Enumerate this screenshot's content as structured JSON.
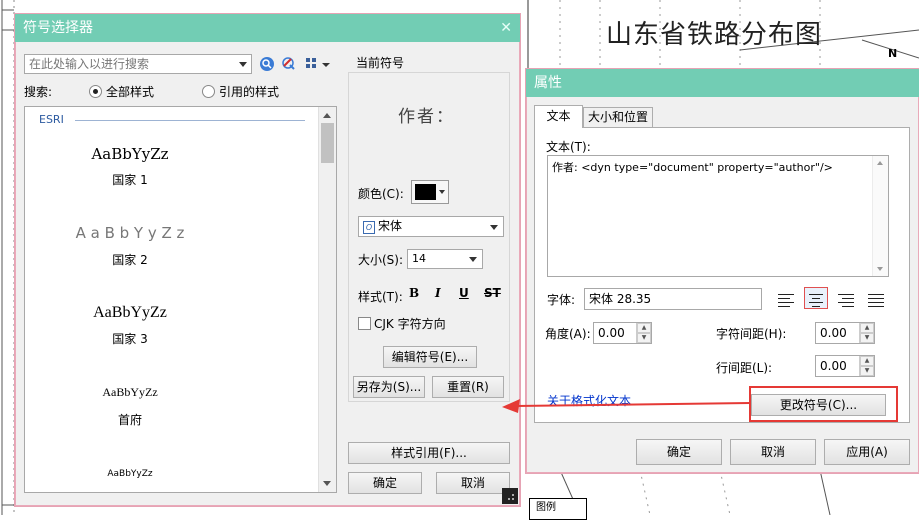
{
  "map": {
    "title": "山东省铁路分布图",
    "north": "N",
    "legend_label": "图例"
  },
  "symbol_selector": {
    "title": "符号选择器",
    "search_placeholder": "在此处输入以进行搜索",
    "search_label": "搜索:",
    "radio_all": "全部样式",
    "radio_referenced": "引用的样式",
    "group_header": "ESRI",
    "samples": [
      {
        "text": "AaBbYyZz",
        "name": "国家 1"
      },
      {
        "text": "A a B b Y y Z z",
        "name": "国家 2"
      },
      {
        "text": "AaBbYyZz",
        "name": "国家 3"
      },
      {
        "text": "AaBbYyZz",
        "name": "首府"
      },
      {
        "text": "AaBbYyZz",
        "name": ""
      }
    ],
    "current_symbol_label": "当前符号",
    "preview_text": "作者：",
    "color_label": "颜色(C):",
    "color_value": "#000000",
    "font_value": "宋体",
    "size_label": "大小(S):",
    "size_value": "14",
    "style_label": "样式(T):",
    "style_bold": "B",
    "style_italic": "I",
    "style_underline": "U",
    "style_strike": "S",
    "cjk_label": "CJK 字符方向",
    "edit_symbol": "编辑符号(E)...",
    "save_as": "另存为(S)...",
    "reset": "重置(R)",
    "style_refs": "样式引用(F)...",
    "ok": "确定",
    "cancel": "取消"
  },
  "properties": {
    "title": "属性",
    "tab_text": "文本",
    "tab_size_position": "大小和位置",
    "text_label": "文本(T):",
    "text_value": "作者: <dyn type=\"document\" property=\"author\"/>",
    "font_label": "字体:",
    "font_value": "宋体 28.35",
    "angle_label": "角度(A):",
    "angle_value": "0.00",
    "char_spacing_label": "字符间距(H):",
    "char_spacing_value": "0.00",
    "line_spacing_label": "行间距(L):",
    "line_spacing_value": "0.00",
    "format_link": "关于格式化文本",
    "change_symbol": "更改符号(C)...",
    "ok": "确定",
    "cancel": "取消",
    "apply": "应用(A)"
  },
  "colors": {
    "titlebar": "#72cdb4",
    "highlight": "#e53935",
    "link": "#0033cc"
  }
}
